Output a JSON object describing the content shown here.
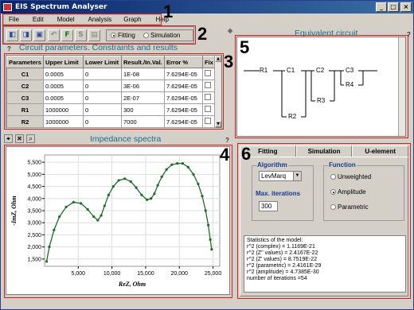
{
  "window": {
    "title": "EIS Spectrum Analyser",
    "controls": [
      "_",
      "□",
      "×"
    ]
  },
  "menu": [
    "File",
    "Edit",
    "Model",
    "Analysis",
    "Graph",
    "Help"
  ],
  "callouts": [
    "1",
    "2",
    "3",
    "4",
    "5",
    "6"
  ],
  "toolbar": {
    "tools": [
      "open-icon",
      "save-icon",
      "copy-icon",
      "undo-icon",
      "fit-icon",
      "simulate-icon",
      "export-icon"
    ],
    "fitting_label": "Fitting",
    "simulation_label": "Simulation",
    "selected_mode": "Fitting"
  },
  "params_panel": {
    "title": "Circuit parameters. Constraints and results",
    "help": "?",
    "columns": [
      "Parameters",
      "Upper Limit",
      "Lower Limit",
      "Result./In.Val.",
      "Error %",
      "Fix"
    ],
    "rows": [
      {
        "name": "C1",
        "upper": "0.0005",
        "lower": "0",
        "result": "1E-08",
        "error": "7.6294E-05"
      },
      {
        "name": "C2",
        "upper": "0.0005",
        "lower": "0",
        "result": "3E-06",
        "error": "7.6294E-05"
      },
      {
        "name": "C3",
        "upper": "0.0005",
        "lower": "0",
        "result": "2E-07",
        "error": "7.6294E-05"
      },
      {
        "name": "R1",
        "upper": "1000000",
        "lower": "0",
        "result": "300",
        "error": "7.6294E-05"
      },
      {
        "name": "R2",
        "upper": "1000000",
        "lower": "0",
        "result": "7000",
        "error": "7.6294E-05"
      }
    ]
  },
  "circuit_panel": {
    "title": "Equivalent circuit",
    "help": "?",
    "labels": {
      "r1": "R1",
      "c1": "C1",
      "c2": "C2",
      "c3": "C3",
      "r2": "R2",
      "r3": "R3",
      "r4": "R4"
    }
  },
  "spectra_panel": {
    "title": "Impedance spectra",
    "help": "?"
  },
  "chart_data": {
    "type": "line",
    "title": "",
    "xlabel": "ReZ, Ohm",
    "ylabel": "-ImZ, Ohm",
    "xlim": [
      0,
      26000
    ],
    "ylim": [
      1200,
      5800
    ],
    "xticks": [
      5000,
      10000,
      15000,
      20000,
      25000
    ],
    "xtick_labels": [
      "5,000",
      "10,000",
      "15,000",
      "20,000",
      "25,000"
    ],
    "yticks": [
      1500,
      2000,
      2500,
      3000,
      3500,
      4000,
      4500,
      5000,
      5500
    ],
    "ytick_labels": [
      "1,500",
      "2,000",
      "2,500",
      "3,000",
      "3,500",
      "4,000",
      "4,500",
      "5,000",
      "5,500"
    ],
    "grid": true,
    "series": [
      {
        "x": [
          300,
          700,
          1400,
          2200,
          3200,
          4300,
          5400,
          6400,
          7300,
          7900,
          8400,
          8900,
          9500,
          10200,
          11000,
          11900,
          12800,
          13600,
          14400,
          15200,
          15800,
          16300,
          16800,
          17400,
          18100,
          18900,
          19700,
          20500,
          21300,
          22100,
          22800,
          23400,
          23900,
          24300,
          24600,
          24800
        ],
        "y": [
          1400,
          2000,
          2700,
          3250,
          3650,
          3850,
          3800,
          3550,
          3250,
          3100,
          3300,
          3700,
          4150,
          4500,
          4750,
          4820,
          4700,
          4450,
          4150,
          3950,
          4000,
          4200,
          4550,
          4900,
          5200,
          5400,
          5450,
          5450,
          5300,
          5000,
          4600,
          4100,
          3500,
          2900,
          2300,
          1900
        ]
      }
    ]
  },
  "right_panel": {
    "tabs": [
      "Fitting",
      "Simulation",
      "U-element"
    ],
    "active_tab": "Fitting",
    "algorithm_label": "Algorithm",
    "algorithm_value": "LevMarq",
    "max_iter_label": "Max. iterations",
    "max_iter_value": "300",
    "function_label": "Function",
    "function_options": [
      "Unweighted",
      "Amplitude",
      "Parametric"
    ],
    "function_selected": "Amplitude",
    "stats": [
      "Statistics of the model:",
      "r^2 (complex) = 1.1169E-21",
      "r^2 (Z'' values) = 2.4167E-22",
      "r^2 (Z' values) = 8.7519E-22",
      "r^2 (parametric) = 2.4161E-29",
      "r^2 (amplitude) = 4.7385E-30",
      "number of iterations =54"
    ]
  }
}
